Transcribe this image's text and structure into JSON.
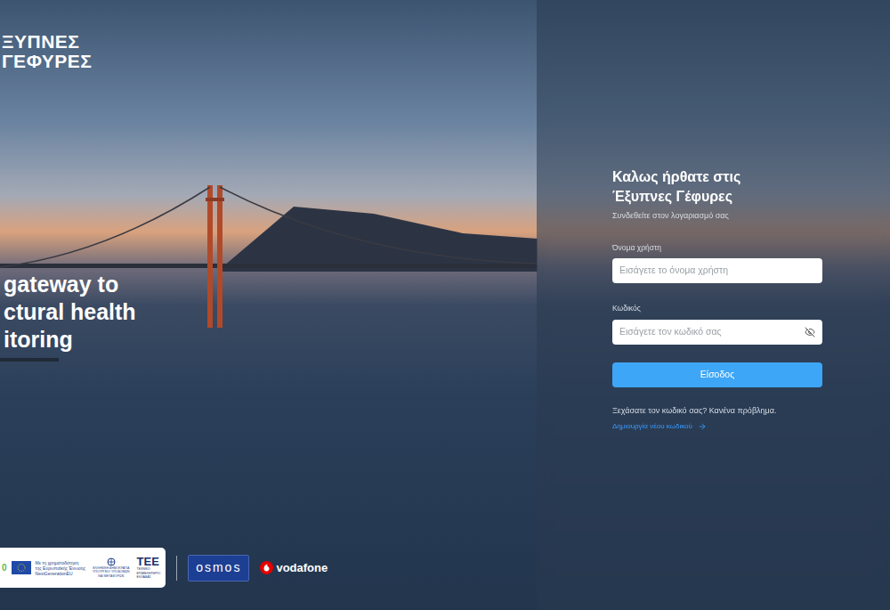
{
  "logo": {
    "lines": [
      "ΞΥΠΝΕΣ",
      "ΓΕΦΥΡΕΣ"
    ]
  },
  "tagline": [
    "gateway to",
    "ctural health",
    "itoring"
  ],
  "login": {
    "title_lines": [
      "Καλως ήρθατε στις",
      "Έξυπνες Γέφυρες"
    ],
    "subtitle": "Συνδεθείτε στον λογαριασμό σας",
    "fields": [
      {
        "label": "Όνομα χρήστη",
        "placeholder": "Εισάγετε το όνομα χρήστη",
        "kind": "text",
        "password_visible": false
      },
      {
        "label": "Κωδικός",
        "placeholder": "Εισάγετε τον κωδικό σας",
        "kind": "password",
        "password_visible": false
      }
    ],
    "submit": "Είσοδος",
    "forgot": "Ξεχάσατε τον κωδικό σας? Κανένα πρόβλημα.",
    "reset_link": "Δημιουργία νέου κωδικού"
  },
  "footer": {
    "funding": {
      "greece": "0",
      "eu_lines": [
        "Με τη χρηματοδότηση",
        "της Ευρωπαϊκής Ένωσης",
        "NextGenerationEU"
      ],
      "ministry_lines": [
        "ΕΛΛΗΝΙΚΗ ΔΗΜΟΚΡΑΤΙΑ",
        "ΥΠΟΥΡΓΕΙΟ ΥΠΟΔΟΜΩΝ",
        "ΚΑΙ ΜΕΤΑΦΟΡΩΝ"
      ],
      "tee": "ΤΕΕ",
      "tee_lines": [
        "ΤΕΧΝΙΚΟ",
        "ΕΠΙΜΕΛΗΤΗΡΙΟ",
        "ΕΛΛΑΔΑΣ"
      ]
    },
    "partners": [
      "osmos",
      "vodafone"
    ]
  }
}
